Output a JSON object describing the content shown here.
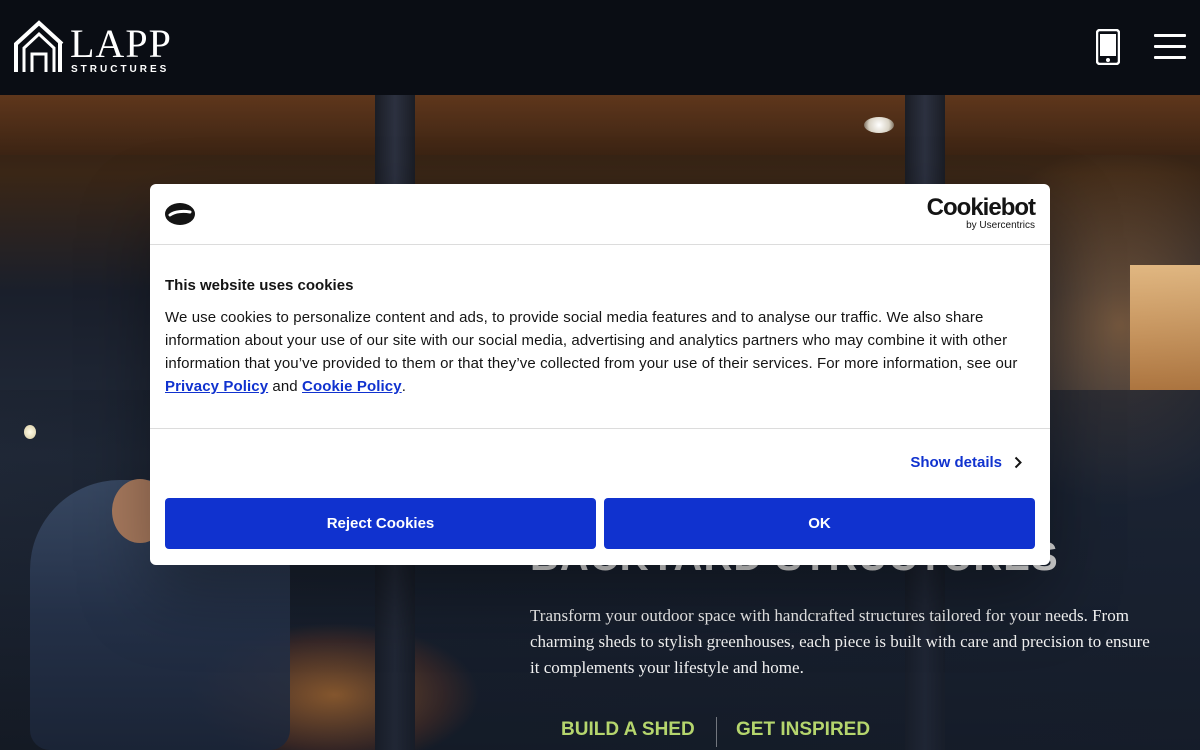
{
  "header": {
    "logo_word": "LAPP",
    "logo_sub": "STRUCTURES",
    "phone_icon": "phone-icon",
    "menu_icon": "hamburger-menu-icon"
  },
  "hero": {
    "title": "BACKYARD STRUCTURES",
    "description": "Transform your outdoor space with handcrafted structures tailored for your needs. From charming sheds to stylish greenhouses, each piece is built with care and precision to ensure it complements your lifestyle and home.",
    "cta_primary": "BUILD A SHED",
    "cta_secondary": "GET INSPIRED",
    "cta_color": "#b5d56d"
  },
  "cookie_dialog": {
    "brand_name": "Cookiebot",
    "brand_sub": "by Usercentrics",
    "title": "This website uses cookies",
    "body_prefix": "We use cookies to personalize content and ads, to provide social media features and to analyse our traffic. We also share information about your use of our site with our social media, advertising and analytics partners who may combine it with other information that you’ve provided to them or that they’ve collected from your use of their services. For more information, see our ",
    "privacy_link": "Privacy Policy",
    "body_and": " and ",
    "cookie_link": "Cookie Policy",
    "body_suffix": ".",
    "show_details": "Show details",
    "reject_label": "Reject Cookies",
    "ok_label": "OK",
    "accent_color": "#1032cf"
  }
}
